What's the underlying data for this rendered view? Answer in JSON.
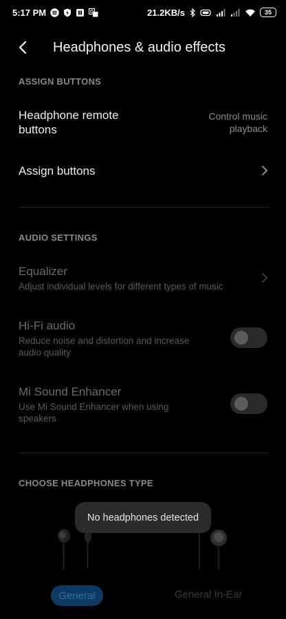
{
  "status_bar": {
    "time": "5:17 PM",
    "speed": "21.2KB/s",
    "battery": "35",
    "icons_left": [
      "spotify-icon",
      "shield-icon",
      "vpn-icon",
      "translate-icon"
    ],
    "icons_right": [
      "bluetooth-icon",
      "signal-icon",
      "signal-icon",
      "wifi-icon",
      "battery-icon"
    ]
  },
  "appbar": {
    "title": "Headphones & audio effects",
    "back_icon": "back-arrow-icon"
  },
  "sections": {
    "assign_buttons": "ASSIGN BUTTONS",
    "audio_settings": "AUDIO SETTINGS",
    "choose_headphones": "CHOOSE HEADPHONES TYPE"
  },
  "rows": {
    "remote": {
      "label_line1": "Headphone remote",
      "label_line2": "buttons",
      "value_line1": "Control music",
      "value_line2": "playback"
    },
    "assign": {
      "label": "Assign buttons"
    },
    "equalizer": {
      "label": "Equalizer",
      "sub": "Adjust individual levels for different types of music"
    },
    "hifi": {
      "label": "Hi-Fi audio",
      "sub_line1": "Reduce noise and distortion and increase",
      "sub_line2": "audio quality",
      "enabled": false
    },
    "mi_sound": {
      "label": "Mi Sound Enhancer",
      "sub_line1": "Use Mi Sound Enhancer when using",
      "sub_line2": "speakers",
      "enabled": false
    }
  },
  "headphones": {
    "options": [
      "General",
      "General In-Ear"
    ],
    "selected": "General"
  },
  "toast": "No headphones detected",
  "colors": {
    "accent": "#0d3a63",
    "background": "#000000"
  }
}
